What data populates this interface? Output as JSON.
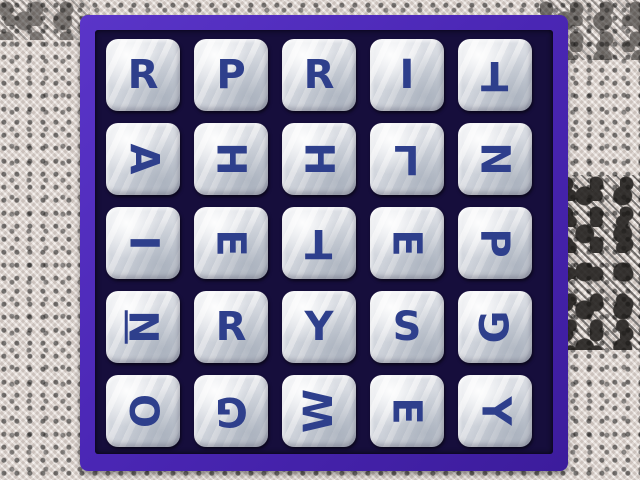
{
  "game": {
    "board": {
      "rows": [
        [
          {
            "letter": "R",
            "rotation": 0
          },
          {
            "letter": "P",
            "rotation": 0
          },
          {
            "letter": "R",
            "rotation": 0
          },
          {
            "letter": "I",
            "rotation": 0
          },
          {
            "letter": "T",
            "rotation": 180
          }
        ],
        [
          {
            "letter": "A",
            "rotation": 90
          },
          {
            "letter": "H",
            "rotation": 90
          },
          {
            "letter": "H",
            "rotation": 90
          },
          {
            "letter": "L",
            "rotation": 180
          },
          {
            "letter": "N",
            "rotation": 90
          }
        ],
        [
          {
            "letter": "I",
            "rotation": 90
          },
          {
            "letter": "E",
            "rotation": 90
          },
          {
            "letter": "T",
            "rotation": 180
          },
          {
            "letter": "E",
            "rotation": 90
          },
          {
            "letter": "P",
            "rotation": 90
          }
        ],
        [
          {
            "letter": "N",
            "rotation": 90,
            "underlined": true
          },
          {
            "letter": "R",
            "rotation": 0
          },
          {
            "letter": "Y",
            "rotation": 0
          },
          {
            "letter": "S",
            "rotation": 0
          },
          {
            "letter": "G",
            "rotation": -90
          }
        ],
        [
          {
            "letter": "O",
            "rotation": 90
          },
          {
            "letter": "G",
            "rotation": 180
          },
          {
            "letter": "W",
            "rotation": -90
          },
          {
            "letter": "E",
            "rotation": 90
          },
          {
            "letter": "Y",
            "rotation": 90
          }
        ]
      ]
    },
    "colors": {
      "tray": "#4a26b4",
      "letter": "#2e3f8c",
      "die": "#e6e8ec",
      "grid": "#160e3c"
    }
  }
}
